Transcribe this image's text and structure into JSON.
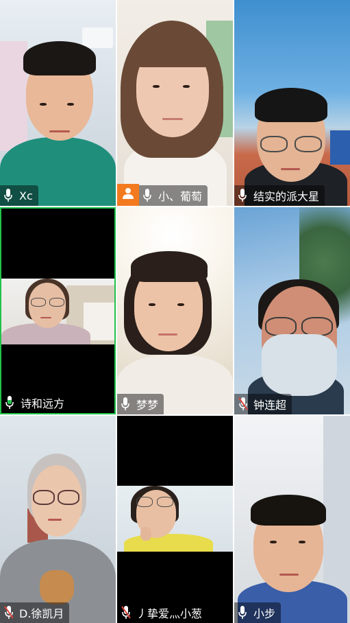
{
  "participants": [
    {
      "name": "Xc",
      "mic": "on"
    },
    {
      "name": "小、葡萄",
      "mic": "on",
      "host": true
    },
    {
      "name": "结实的派大星",
      "mic": "on"
    },
    {
      "name": "诗和远方",
      "mic": "active"
    },
    {
      "name": "梦梦",
      "mic": "on"
    },
    {
      "name": "钟连超",
      "mic": "muted"
    },
    {
      "name": "D.徐凯月",
      "mic": "muted"
    },
    {
      "name": "丿挚爱灬小葱",
      "mic": "muted"
    },
    {
      "name": "小步",
      "mic": "on"
    }
  ],
  "colors": {
    "active_speaker": "#21c24a",
    "host_badge": "#f37a1f",
    "muted_mic": "#e0453c"
  },
  "icons": {
    "mic": "microphone-icon",
    "muted": "microphone-muted-icon",
    "host": "person-icon"
  }
}
